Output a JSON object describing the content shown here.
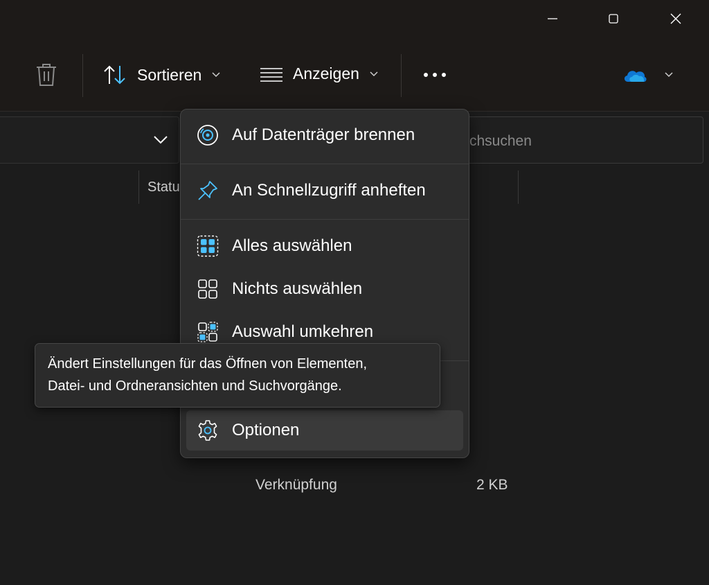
{
  "window": {
    "minimize_icon": "minimize-icon",
    "maximize_icon": "maximize-icon",
    "close_icon": "close-icon"
  },
  "toolbar": {
    "delete_icon": "trash-icon",
    "sort_label": "Sortieren",
    "view_label": "Anzeigen",
    "more_icon": "more-icon",
    "cloud_icon": "onedrive-icon"
  },
  "search": {
    "placeholder": "chsuchen"
  },
  "columns": {
    "status": "Statu"
  },
  "row": {
    "type": "Verknüpfung",
    "size": "2 KB"
  },
  "menu": {
    "items": [
      {
        "label": "Auf Datenträger brennen",
        "icon": "disc-burn-icon"
      },
      {
        "label": "An Schnellzugriff anheften",
        "icon": "pin-icon"
      },
      {
        "label": "Alles auswählen",
        "icon": "select-all-icon"
      },
      {
        "label": "Nichts auswählen",
        "icon": "select-none-icon"
      },
      {
        "label": "Auswahl umkehren",
        "icon": "invert-selection-icon"
      },
      {
        "label": "Optionen",
        "icon": "gear-icon"
      }
    ]
  },
  "tooltip": {
    "line1": "Ändert Einstellungen für das Öffnen von Elementen,",
    "line2": "Datei- und Ordneransichten und Suchvorgänge."
  },
  "colors": {
    "accent": "#4cc2ff",
    "onedrive": "#0f78d4",
    "menu_bg": "#2c2c2c"
  }
}
